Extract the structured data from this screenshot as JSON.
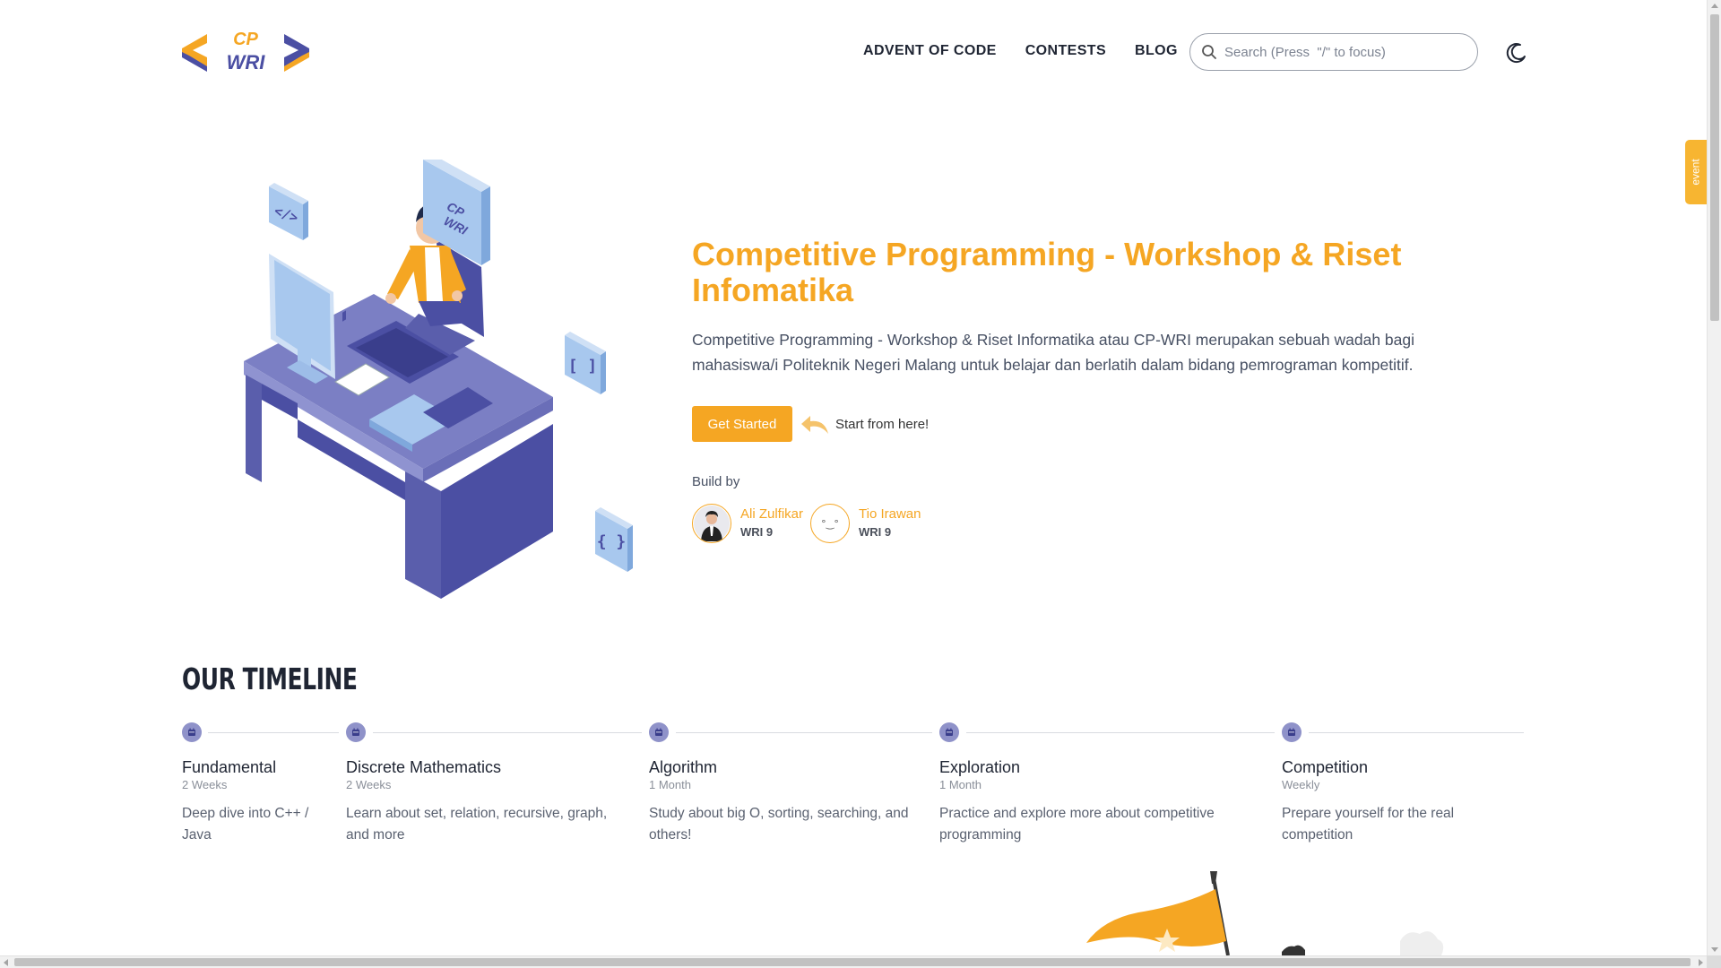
{
  "header": {
    "logo_text_top": "CP",
    "logo_text_bottom": "WRI",
    "nav": [
      "ADVENT OF CODE",
      "CONTESTS",
      "BLOG"
    ],
    "search_placeholder": "Search (Press  \"/\" to focus)",
    "theme_toggle_icon": "moon-icon"
  },
  "event_tab": {
    "label": "event"
  },
  "hero": {
    "title": "Competitive Programming - Workshop & Riset Infomatika",
    "description": "Competitive Programming - Workshop & Riset Informatika atau CP-WRI merupakan sebuah wadah bagi mahasiswa/i Politeknik Negeri Malang untuk belajar dan berlatih dalam bidang pemrograman kompetitif.",
    "cta_button": "Get Started",
    "cta_hint": "Start from here!",
    "build_by_label": "Build by",
    "builders": [
      {
        "name": "Ali Zulfikar",
        "group": "WRI 9",
        "avatar": "photo"
      },
      {
        "name": "Tio Irawan",
        "group": "WRI 9",
        "avatar": "°‿°"
      }
    ],
    "illustration": {
      "monitor_sign": "CP WRI",
      "code_tiles": [
        "</>",
        "[ ]",
        "{ }"
      ]
    }
  },
  "timeline": {
    "title": "OUR TIMELINE",
    "items": [
      {
        "name": "Fundamental",
        "duration": "2 Weeks",
        "description": "Deep dive into C++ / Java"
      },
      {
        "name": "Discrete Mathematics",
        "duration": "2 Weeks",
        "description": "Learn about set, relation, recursive, graph, and more"
      },
      {
        "name": "Algorithm",
        "duration": "1 Month",
        "description": "Study about big O, sorting, searching, and others!"
      },
      {
        "name": "Exploration",
        "duration": "1 Month",
        "description": "Practice and explore more about competitive programming"
      },
      {
        "name": "Competition",
        "duration": "Weekly",
        "description": "Prepare yourself for the real competition"
      }
    ]
  },
  "colors": {
    "accent": "#f5a623",
    "brand_purple": "#4b4fa3",
    "timeline_dot": "#8f92c9",
    "text_dark": "#1f2533"
  }
}
